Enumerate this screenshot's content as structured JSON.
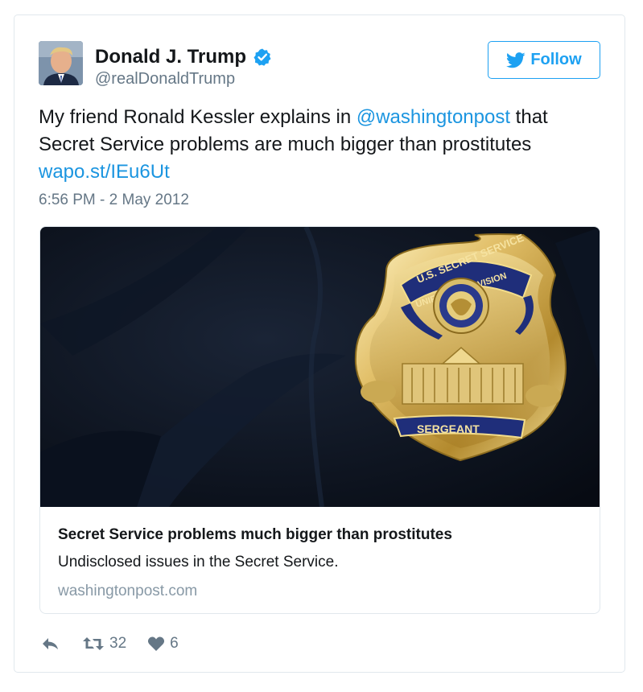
{
  "author": {
    "name": "Donald J. Trump",
    "handle": "@realDonaldTrump",
    "verified": true
  },
  "follow_label": "Follow",
  "tweet": {
    "text_part1": "My friend Ronald Kessler explains in ",
    "mention": "@washingtonpost",
    "text_part2": " that Secret Service problems are much bigger than prostitutes ",
    "link": "wapo.st/IEu6Ut",
    "timestamp": "6:56 PM - 2 May 2012"
  },
  "card": {
    "image_badge_top": "U.S. SECRET SERVICE",
    "image_badge_middle": "UNIFORMED DIVISION",
    "image_badge_bottom": "SERGEANT",
    "title": "Secret Service problems much bigger than prostitutes",
    "description": "Undisclosed issues in the Secret Service.",
    "domain": "washingtonpost.com"
  },
  "actions": {
    "reply_icon": "reply-icon",
    "retweet_count": "32",
    "like_count": "6"
  },
  "colors": {
    "accent": "#1da1f2",
    "link": "#1b95e0",
    "muted": "#657786"
  }
}
